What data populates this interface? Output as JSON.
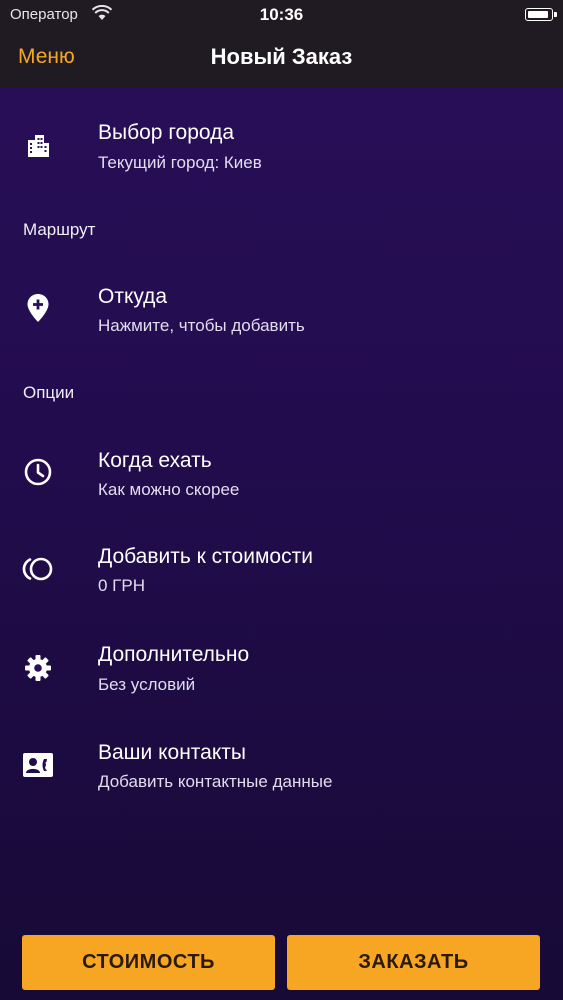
{
  "status_bar": {
    "carrier": "Оператор",
    "time": "10:36",
    "battery_level": 0.95
  },
  "nav": {
    "menu_label": "Меню",
    "title": "Новый Заказ"
  },
  "city": {
    "icon": "city-building-icon",
    "title": "Выбор города",
    "subtitle": "Текущий город: Киев"
  },
  "sections": {
    "route": "Маршрут",
    "options": "Опции"
  },
  "route_from": {
    "icon": "add-location-icon",
    "title": "Откуда",
    "subtitle": "Нажмите, чтобы добавить"
  },
  "options": [
    {
      "icon": "clock-icon",
      "title": "Когда ехать",
      "subtitle": "Как можно скорее"
    },
    {
      "icon": "coins-icon",
      "title": "Добавить к стоимости",
      "subtitle": "0 ГРН"
    },
    {
      "icon": "gear-icon",
      "title": "Дополнительно",
      "subtitle": "Без условий"
    },
    {
      "icon": "contact-card-icon",
      "title": "Ваши контакты",
      "subtitle": "Добавить контактные данные"
    }
  ],
  "buttons": {
    "cost": "СТОИМОСТЬ",
    "order": "ЗАКАЗАТЬ"
  },
  "colors": {
    "accent": "#f5a623",
    "nav_background": "#201a22",
    "background_top": "#2a0f59",
    "background_bottom": "#170a36"
  }
}
